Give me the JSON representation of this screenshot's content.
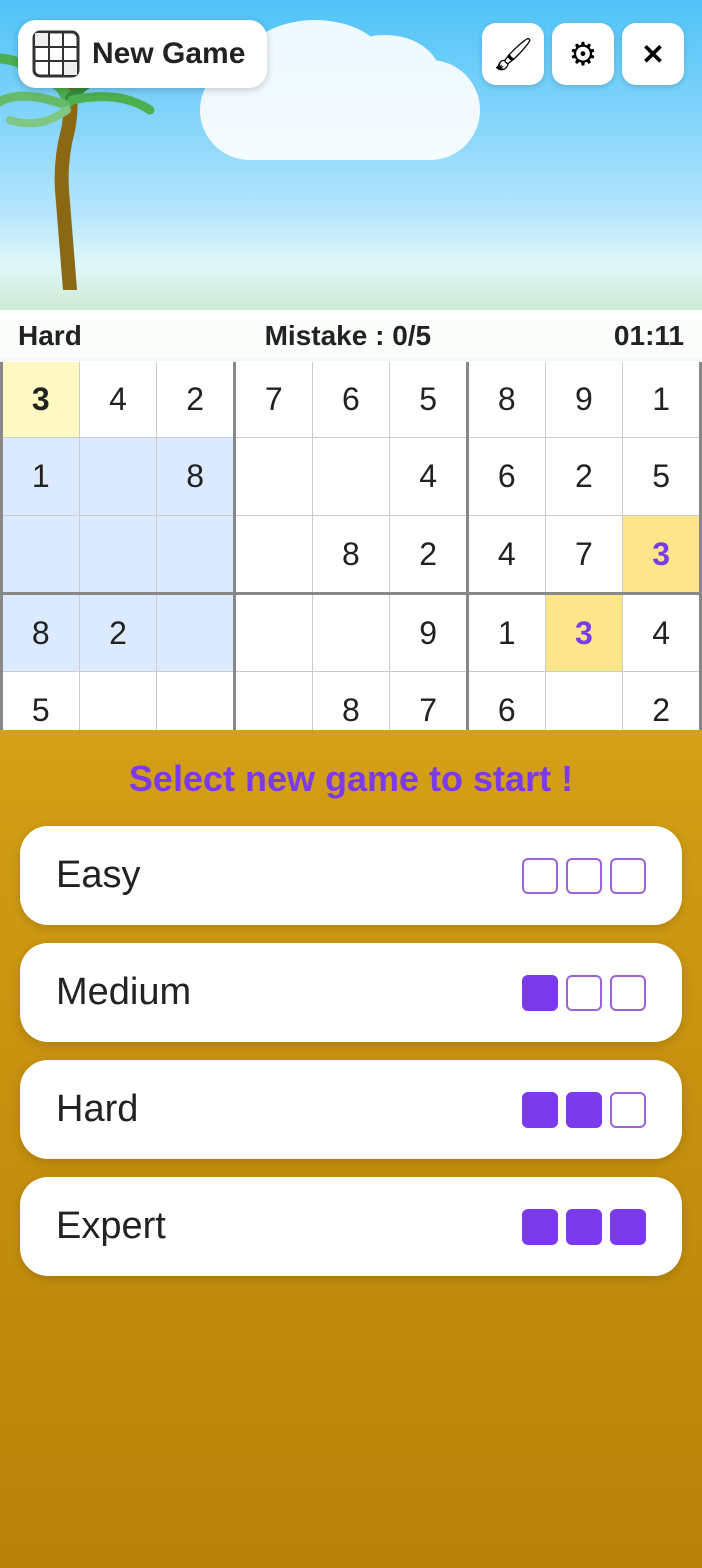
{
  "topBar": {
    "newGame": "New Game",
    "brushIcon": "🖌",
    "settingsIcon": "⚙",
    "closeIcon": "✕"
  },
  "statusBar": {
    "difficulty": "Hard",
    "mistake": "Mistake : 0/5",
    "timer": "01:11"
  },
  "grid": {
    "rows": [
      [
        "3",
        "4",
        "2",
        "7",
        "6",
        "5",
        "8",
        "9",
        "1"
      ],
      [
        "1",
        "",
        "8",
        "",
        "",
        "4",
        "6",
        "2",
        "5"
      ],
      [
        "",
        "",
        "",
        "",
        "8",
        "2",
        "4",
        "7",
        "3"
      ],
      [
        "8",
        "2",
        "",
        "",
        "",
        "9",
        "1",
        "3",
        "4"
      ],
      [
        "5",
        "",
        "",
        "",
        "8",
        "7",
        "6",
        "",
        "2"
      ]
    ],
    "highlights": {
      "yellow": [
        [
          0,
          0
        ]
      ],
      "gold": [
        [
          2,
          8
        ],
        [
          3,
          7
        ]
      ]
    }
  },
  "overlay": {
    "selectText": "Select new game to start !",
    "difficulties": [
      {
        "label": "Easy",
        "filledDots": 0,
        "totalDots": 3
      },
      {
        "label": "Medium",
        "filledDots": 1,
        "totalDots": 3
      },
      {
        "label": "Hard",
        "filledDots": 2,
        "totalDots": 3
      },
      {
        "label": "Expert",
        "filledDots": 3,
        "totalDots": 3
      }
    ]
  }
}
